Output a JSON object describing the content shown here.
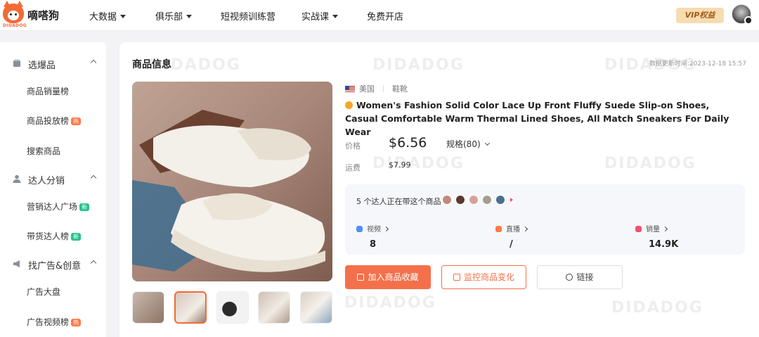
{
  "header": {
    "logo_text": "嘀嗒狗",
    "logo_sub": "DIDADOG",
    "nav": [
      {
        "label": "大数据",
        "dropdown": true
      },
      {
        "label": "俱乐部",
        "dropdown": true
      },
      {
        "label": "短视频训练营",
        "dropdown": false
      },
      {
        "label": "实战课",
        "dropdown": true
      },
      {
        "label": "免费开店",
        "dropdown": false
      }
    ],
    "vip_label": "VIP权益"
  },
  "sidebar": {
    "groups": [
      {
        "label": "选爆品",
        "icon": "box-icon",
        "items": [
          {
            "label": "商品销量榜",
            "tag": ""
          },
          {
            "label": "商品投放榜",
            "tag": "热"
          },
          {
            "label": "搜索商品",
            "tag": ""
          }
        ]
      },
      {
        "label": "达人分销",
        "icon": "user-icon",
        "items": [
          {
            "label": "营销达人广场",
            "tag": "新"
          },
          {
            "label": "带货达人榜",
            "tag": "新"
          }
        ]
      },
      {
        "label": "找广告&创意",
        "icon": "megaphone-icon",
        "items": [
          {
            "label": "广告大盘",
            "tag": ""
          },
          {
            "label": "广告视频榜",
            "tag": "热"
          }
        ]
      }
    ]
  },
  "product": {
    "section_title": "商品信息",
    "updated_at": "数据更新时间:2023-12-18 15:57",
    "watermark": "DIDADOG",
    "country": "美国",
    "category": "鞋靴",
    "title": "Women's Fashion Solid Color Lace Up Front Fluffy Suede Slip-on Shoes, Casual Comfortable Warm Thermal Lined Shoes, All Match Sneakers For Daily Wear",
    "price_label": "价格",
    "price": "$6.56",
    "spec_label": "规格(80)",
    "shipping_label": "运费",
    "shipping": "$7.99",
    "thumbnail_count": 5,
    "active_thumbnail": 2
  },
  "creators": {
    "headline": "5 个达人正在带这个商品",
    "stats": [
      {
        "label": "视频",
        "value": "8",
        "icon": "video-icon"
      },
      {
        "label": "直播",
        "value": "/",
        "icon": "live-icon"
      },
      {
        "label": "销量",
        "value": "14.9K",
        "icon": "bag-icon"
      }
    ]
  },
  "actions": {
    "favorite": "加入商品收藏",
    "monitor": "监控商品变化",
    "link": "链接"
  },
  "colors": {
    "brand": "#f26a35",
    "primary_button": "#f4704a",
    "vip_bg": "#f7dcb0"
  }
}
